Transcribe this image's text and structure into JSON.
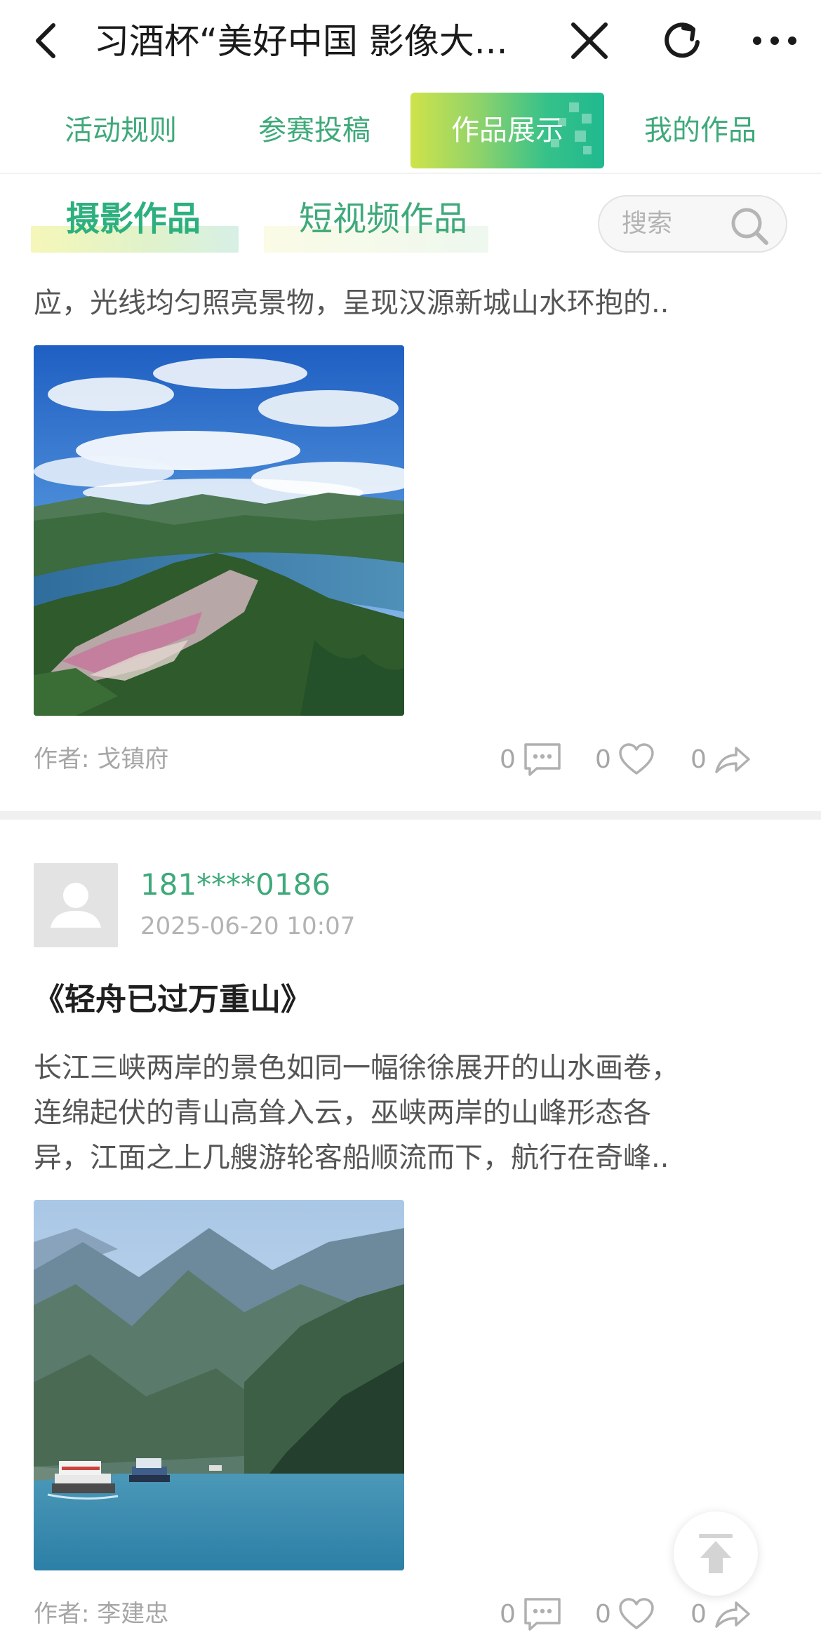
{
  "nav": {
    "title": "习酒杯“美好中国 影像大...",
    "back_icon": "chevron-left-icon",
    "close_icon": "close-icon",
    "refresh_icon": "refresh-icon",
    "more_icon": "more-horizontal-icon"
  },
  "tabs": {
    "items": [
      {
        "label": "活动规则",
        "active": false
      },
      {
        "label": "参赛投稿",
        "active": false
      },
      {
        "label": "作品展示",
        "active": true
      },
      {
        "label": "我的作品",
        "active": false
      }
    ]
  },
  "subtabs": {
    "items": [
      {
        "label": "摄影作品",
        "active": true
      },
      {
        "label": "短视频作品",
        "active": false
      }
    ]
  },
  "search": {
    "placeholder": "搜索"
  },
  "posts": [
    {
      "description_visible": "应，光线均匀照亮景物，呈现汉源新城山水环抱的..",
      "author": "作者: 戈镇府",
      "comments": "0",
      "likes": "0",
      "shares": "0"
    },
    {
      "username": "181****0186",
      "time": "2025-06-20 10:07",
      "title": "《轻舟已过万重山》",
      "description_lines": [
        "长江三峡两岸的景色如同一幅徐徐展开的山水画卷，",
        "连绵起伏的青山高耸入云，巫峡两岸的山峰形态各",
        "异，江面之上几艘游轮客船顺流而下，航行在奇峰.."
      ],
      "author": "作者: 李建忠",
      "comments": "0",
      "likes": "0",
      "shares": "0"
    }
  ],
  "colors": {
    "accent": "#3fa97a",
    "tab_gradient_start": "#cfe34a",
    "tab_gradient_end": "#20b98e"
  },
  "icons": [
    "comment-icon",
    "heart-icon",
    "share-icon",
    "search-icon",
    "back-to-top-icon",
    "user-avatar-icon"
  ]
}
